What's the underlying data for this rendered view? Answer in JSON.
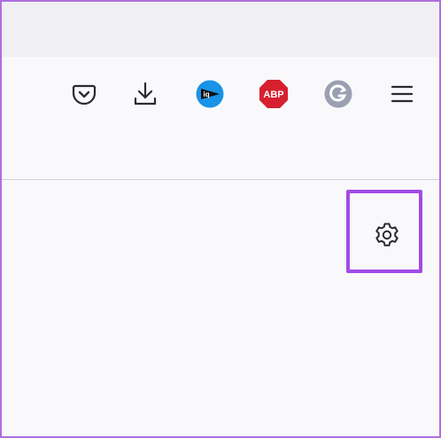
{
  "toolbar": {
    "buttons": [
      {
        "name": "pocket",
        "icon": "pocket-icon"
      },
      {
        "name": "downloads",
        "icon": "download-icon"
      },
      {
        "name": "iq-extension",
        "icon": "iq-extension-icon",
        "text": "iq",
        "color": "#1a93e6"
      },
      {
        "name": "adblock-plus",
        "icon": "abp-icon",
        "text": "ABP",
        "color": "#d6202f"
      },
      {
        "name": "grammarly",
        "icon": "grammarly-icon",
        "color": "#9aa0b2"
      },
      {
        "name": "app-menu",
        "icon": "hamburger-menu-icon"
      }
    ]
  },
  "content": {
    "settings_icon": "gear-icon",
    "highlight_color": "#a24be8"
  },
  "colors": {
    "frame_border": "#b06ee0",
    "tabstrip_bg": "#f0f0f4",
    "toolbar_bg": "#f9f9fb",
    "icon_color": "#2b2a33"
  }
}
